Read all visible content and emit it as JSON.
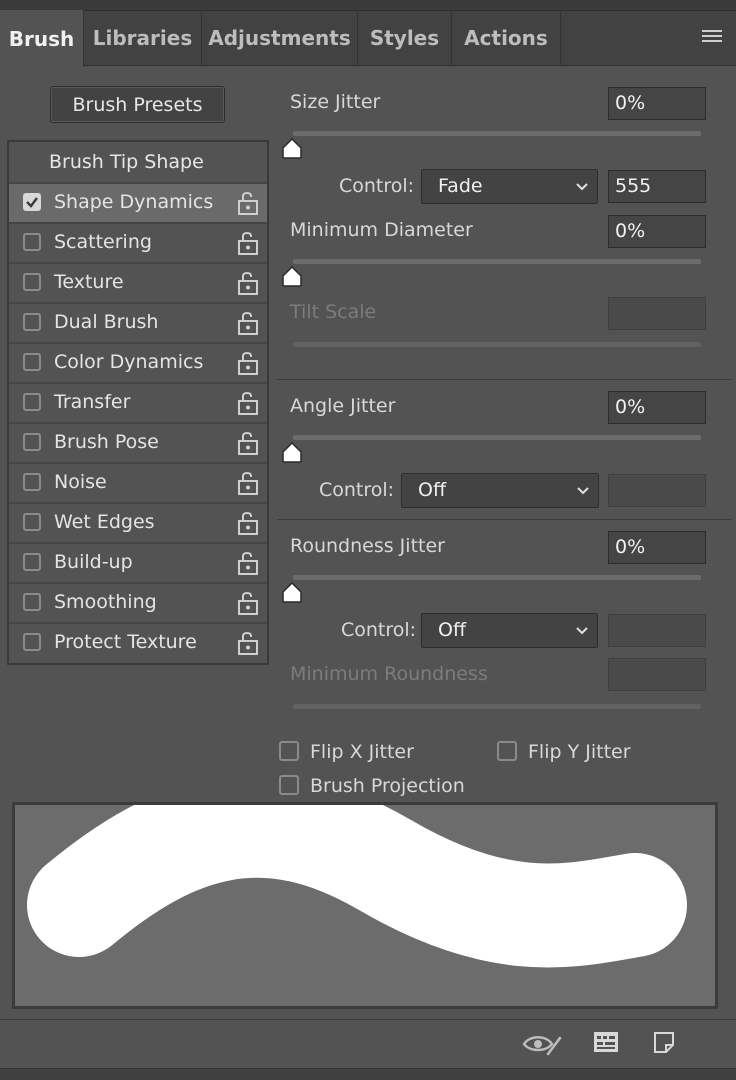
{
  "tabs": [
    {
      "label": "Brush",
      "active": true
    },
    {
      "label": "Libraries",
      "active": false
    },
    {
      "label": "Adjustments",
      "active": false
    },
    {
      "label": "Styles",
      "active": false
    },
    {
      "label": "Actions",
      "active": false
    }
  ],
  "icons": {
    "panel_menu": "hamburger-menu-icon",
    "toggle_preview": "eye-brush-icon",
    "brush_panel": "grid-panel-icon",
    "new_brush": "new-brush-icon",
    "lock": "unlock-icon",
    "check": "checkmark-icon",
    "dropdown": "chevron-down-icon"
  },
  "presets_button": "Brush Presets",
  "left_list": {
    "header": "Brush Tip Shape",
    "items": [
      {
        "label": "Shape Dynamics",
        "checked": true,
        "selected": true
      },
      {
        "label": "Scattering",
        "checked": false
      },
      {
        "label": "Texture",
        "checked": false
      },
      {
        "label": "Dual Brush",
        "checked": false
      },
      {
        "label": "Color Dynamics",
        "checked": false
      },
      {
        "label": "Transfer",
        "checked": false
      },
      {
        "label": "Brush Pose",
        "checked": false
      },
      {
        "label": "Noise",
        "checked": false
      },
      {
        "label": "Wet Edges",
        "checked": false
      },
      {
        "label": "Build-up",
        "checked": false
      },
      {
        "label": "Smoothing",
        "checked": false
      },
      {
        "label": "Protect Texture",
        "checked": false
      }
    ]
  },
  "size_jitter": {
    "label": "Size Jitter",
    "value": "0%",
    "slider_fraction": 0
  },
  "size_control": {
    "label": "Control:",
    "value": "Fade",
    "steps": "555"
  },
  "min_diameter": {
    "label": "Minimum Diameter",
    "value": "0%",
    "slider_fraction": 0
  },
  "tilt_scale": {
    "label": "Tilt Scale",
    "value": "",
    "disabled": true
  },
  "angle_jitter": {
    "label": "Angle Jitter",
    "value": "0%",
    "slider_fraction": 0
  },
  "angle_control": {
    "label": "Control:",
    "value": "Off"
  },
  "roundness_jitter": {
    "label": "Roundness Jitter",
    "value": "0%",
    "slider_fraction": 0
  },
  "roundness_control": {
    "label": "Control:",
    "value": "Off"
  },
  "min_roundness": {
    "label": "Minimum Roundness",
    "value": "",
    "disabled": true
  },
  "options": {
    "flip_x": {
      "label": "Flip X Jitter",
      "checked": false
    },
    "flip_y": {
      "label": "Flip Y Jitter",
      "checked": false
    },
    "projection": {
      "label": "Brush Projection",
      "checked": false
    }
  },
  "colors": {
    "panel": "#535353",
    "tabbar": "#424242",
    "preview_bg": "#6c6c6c",
    "stroke": "#ffffff"
  }
}
